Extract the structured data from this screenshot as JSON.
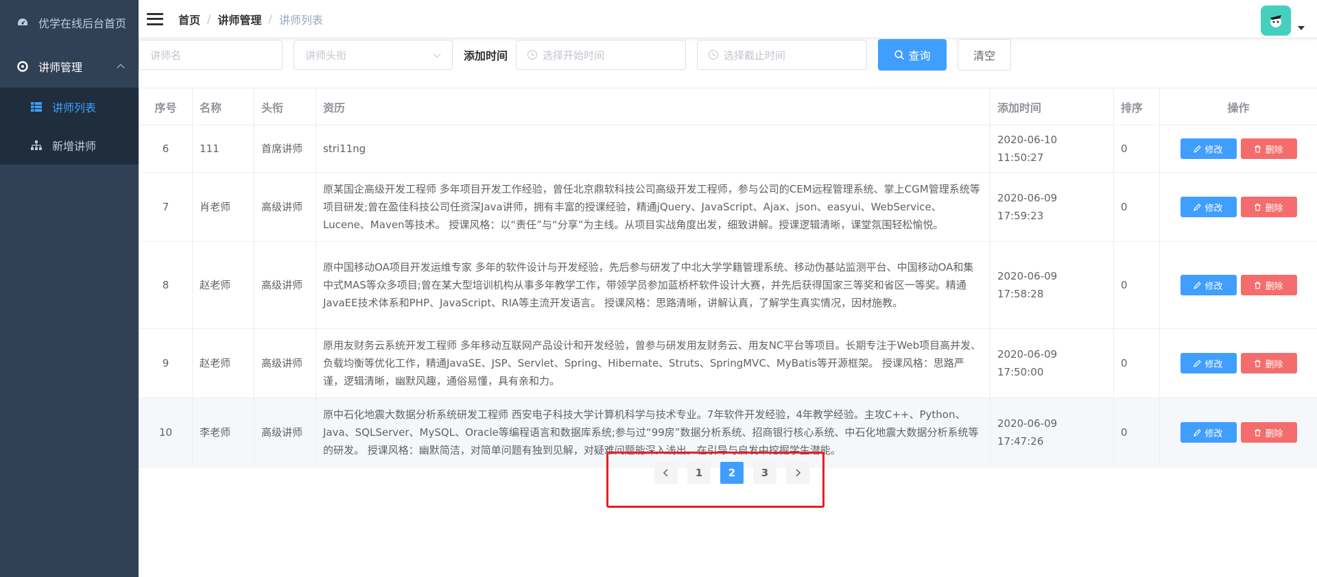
{
  "sidebar": {
    "home_label": "优学在线后台首页",
    "group_label": "讲师管理",
    "items": [
      {
        "label": "讲师列表",
        "active": true
      },
      {
        "label": "新增讲师",
        "active": false
      }
    ]
  },
  "navbar": {
    "breadcrumb": [
      "首页",
      "讲师管理",
      "讲师列表"
    ]
  },
  "filter": {
    "name_placeholder": "讲师名",
    "title_placeholder": "讲师头衔",
    "time_label": "添加时间",
    "start_placeholder": "选择开始时间",
    "end_placeholder": "选择截止时间",
    "query_label": "查询",
    "clear_label": "清空"
  },
  "table": {
    "headers": [
      "序号",
      "名称",
      "头衔",
      "资历",
      "添加时间",
      "排序",
      "操作"
    ],
    "edit_label": "修改",
    "delete_label": "删除",
    "rows": [
      {
        "no": "6",
        "name": "111",
        "title": "首席讲师",
        "intro": "stri11ng",
        "time": "2020-06-10 11:50:27",
        "sort": "0"
      },
      {
        "no": "7",
        "name": "肖老师",
        "title": "高级讲师",
        "intro": "原某国企高级开发工程师 多年项目开发工作经验，曾任北京鼎软科技公司高级开发工程师，参与公司的CEM远程管理系统、掌上CGM管理系统等项目研发;曾在盈佳科技公司任资深Java讲师，拥有丰富的授课经验，精通jQuery、JavaScript、Ajax、json、easyui、WebService、Lucene、Maven等技术。 授课风格：以“责任”与“分享”为主线。从项目实战角度出发，细致讲解。授课逻辑清晰，课堂氛围轻松愉悦。",
        "time": "2020-06-09 17:59:23",
        "sort": "0"
      },
      {
        "no": "8",
        "name": "赵老师",
        "title": "高级讲师",
        "intro": "原中国移动OA项目开发运维专家 多年的软件设计与开发经验，先后参与研发了中北大学学籍管理系统、移动伪基站监测平台、中国移动OA和集中式MAS等众多项目;曾在某大型培训机构从事多年教学工作，带领学员参加蓝桥杯软件设计大赛，并先后获得国家三等奖和省区一等奖。精通JavaEE技术体系和PHP、JavaScript、RIA等主流开发语言。 授课风格：思路清晰，讲解认真，了解学生真实情况，因材施教。",
        "time": "2020-06-09 17:58:28",
        "sort": "0"
      },
      {
        "no": "9",
        "name": "赵老师",
        "title": "高级讲师",
        "intro": "原用友财务云系统开发工程师 多年移动互联网产品设计和开发经验，曾参与研发用友财务云、用友NC平台等项目。长期专注于Web项目高并发、负载均衡等优化工作，精通JavaSE、JSP、Servlet、Spring、Hibernate、Struts、SpringMVC、MyBatis等开源框架。 授课风格：思路严谨，逻辑清晰，幽默风趣，通俗易懂，具有亲和力。",
        "time": "2020-06-09 17:50:00",
        "sort": "0"
      },
      {
        "no": "10",
        "name": "李老师",
        "title": "高级讲师",
        "intro": "原中石化地震大数据分析系统研发工程师 西安电子科技大学计算机科学与技术专业。7年软件开发经验，4年教学经验。主攻C++、Python、Java、SQLServer、MySQL、Oracle等编程语言和数据库系统;参与过“99房”数据分析系统、招商银行核心系统、中石化地震大数据分析系统等的研发。 授课风格：幽默简洁，对简单问题有独到见解，对疑难问题能深入浅出。在引导与启发中挖掘学生潜能。",
        "time": "2020-06-09 17:47:26",
        "sort": "0"
      }
    ]
  },
  "pagination": {
    "pages": [
      "1",
      "2",
      "3"
    ],
    "current": "2"
  },
  "colors": {
    "sidebar_bg": "#304156",
    "submenu_bg": "#1f2d3d",
    "primary": "#409eff",
    "danger": "#f56c6c",
    "highlight": "#e81c24"
  },
  "icons": [
    "dashboard-icon",
    "teacher-group-icon",
    "table-icon",
    "tree-icon",
    "hamburger-icon",
    "search-icon",
    "clock-icon",
    "edit-icon",
    "delete-icon",
    "chevron-left-icon",
    "chevron-right-icon"
  ]
}
